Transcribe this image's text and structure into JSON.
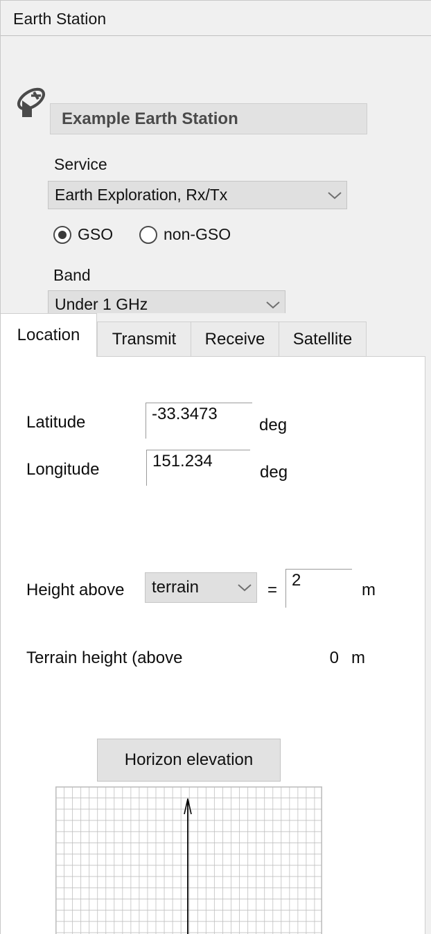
{
  "window": {
    "title": "Earth Station"
  },
  "header": {
    "icon": "satellite-dish-icon",
    "station_name": "Example Earth Station",
    "service_label": "Service",
    "service_value": "Earth Exploration, Rx/Tx",
    "orbit_options": [
      {
        "label": "GSO",
        "selected": true
      },
      {
        "label": "non-GSO",
        "selected": false
      }
    ],
    "band_label": "Band",
    "band_value": "Under 1 GHz",
    "dropdown_icon": "chevron-down-icon"
  },
  "tabs": [
    {
      "label": "Location",
      "active": true
    },
    {
      "label": "Transmit",
      "active": false
    },
    {
      "label": "Receive",
      "active": false
    },
    {
      "label": "Satellite",
      "active": false
    }
  ],
  "location": {
    "latitude_label": "Latitude",
    "latitude_value": "-33.3473",
    "latitude_unit": "deg",
    "longitude_label": "Longitude",
    "longitude_value": "151.234",
    "longitude_unit": "deg",
    "height_above_label": "Height above",
    "height_reference_value": "terrain",
    "equals_sign": "=",
    "height_value": "2",
    "height_unit": "m",
    "terrain_height_label": "Terrain height (above",
    "terrain_height_value": "0",
    "terrain_height_unit": "m",
    "horizon_button_label": "Horizon elevation"
  },
  "chart_data": {
    "type": "line",
    "title": "",
    "xlabel": "",
    "ylabel": "",
    "grid": true,
    "grid_columns": 32,
    "grid_rows": 13,
    "grid_color": "#bfbfbf",
    "series": [
      {
        "name": "horizon-pointer",
        "marker": "up-arrow",
        "color": "#000000",
        "x": [
          0.5,
          0.5
        ],
        "y": [
          0.0,
          0.93
        ]
      }
    ],
    "xlim": [
      0,
      1
    ],
    "ylim": [
      0,
      1
    ]
  },
  "colors": {
    "window_background": "#f0f0f0",
    "panel_background": "#ffffff",
    "control_background": "#e0e0e0",
    "border": "#c8c8c8",
    "text": "#141414",
    "muted_text": "#4a4a4a",
    "grid": "#bfbfbf"
  }
}
